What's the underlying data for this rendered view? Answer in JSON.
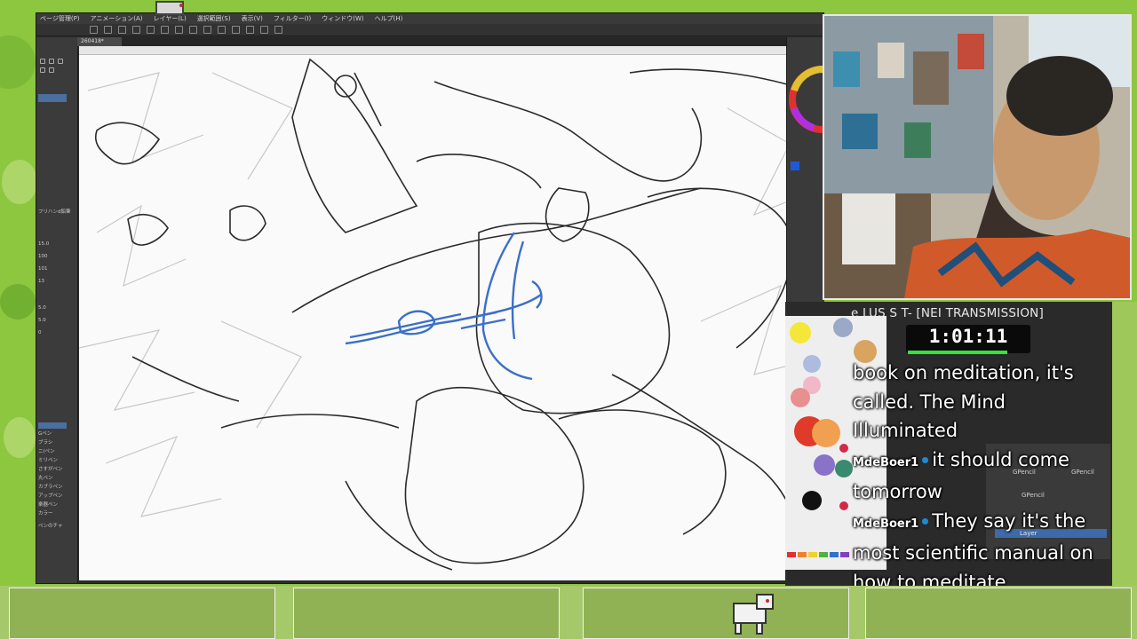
{
  "app": {
    "menus": [
      "ページ管理(P)",
      "アニメーション(A)",
      "レイヤー(L)",
      "選択範囲(S)",
      "表示(V)",
      "フィルター(I)",
      "ウィンドウ(W)",
      "ヘルプ(H)"
    ],
    "tab_label": "260418*",
    "left_panel": {
      "brush_label": "フリハンd鉛筆",
      "size_values": [
        "15.0",
        "100",
        "101",
        "13"
      ],
      "sub_values": [
        "5.0",
        "5.0",
        "0"
      ],
      "tool_list": [
        "Gペン",
        "ブラシ",
        "ニ(ペン",
        "ミリペン",
        "さすがペン",
        "丸ペン",
        "カブラペン",
        "アップペン",
        "楽器ペン",
        "カラー",
        "ペンのチャ"
      ]
    }
  },
  "stream": {
    "title": "e LUS S T- [NEI TRANSMISSION]",
    "timer": "1:01:11",
    "timer_progress": 0.8
  },
  "chat": {
    "messages": [
      {
        "user": "",
        "text": "book on meditation, it's called. The Mind Illuminated"
      },
      {
        "user": "MdeBoer1",
        "text": "it should come tomorrow"
      },
      {
        "user": "MdeBoer1",
        "text": "They say it's the most scientific manual on how to meditate"
      }
    ]
  },
  "layers_panel": {
    "items": [
      "GPencil",
      "GPencil",
      "GPencil",
      "Layer"
    ]
  },
  "colors": {
    "accent_green": "#36e23e",
    "canvas": "#fafafa",
    "ui_dark": "#2b2b2b",
    "sketch_blue": "#3b6fc9"
  }
}
